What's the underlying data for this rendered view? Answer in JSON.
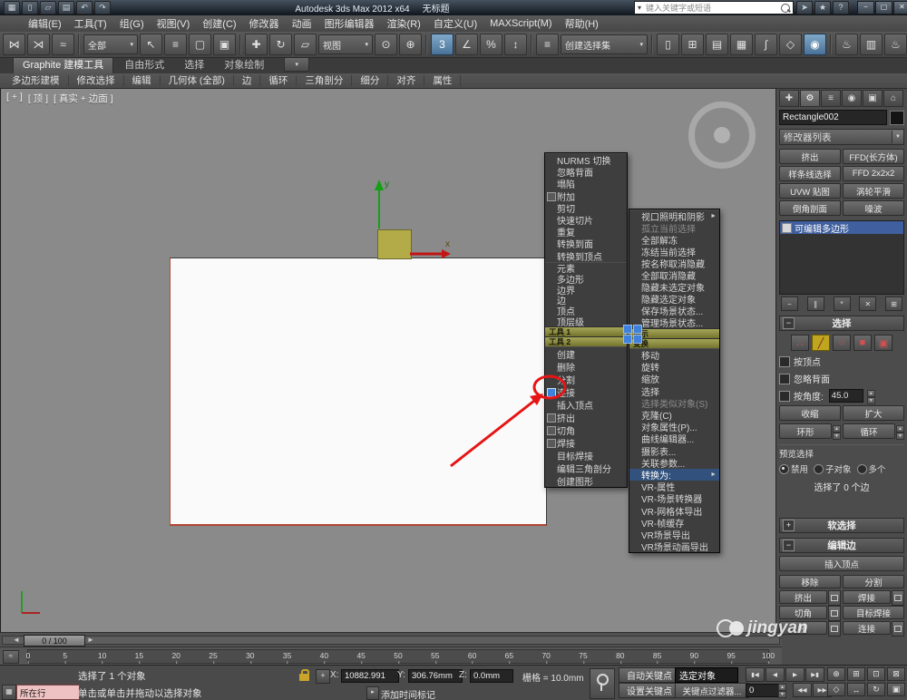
{
  "titlebar": {
    "title": "Autodesk 3ds Max 2012 x64",
    "doc": "无标题",
    "search_placeholder": "键入关键字或短语",
    "qat_icons": [
      {
        "glyph": "▦",
        "name": "app-menu-icon"
      },
      {
        "glyph": "▯",
        "name": "new-scene-icon"
      },
      {
        "glyph": "▱",
        "name": "open-file-icon"
      },
      {
        "glyph": "▤",
        "name": "save-file-icon"
      },
      {
        "glyph": "↶",
        "name": "undo-icon"
      },
      {
        "glyph": "↷",
        "name": "redo-icon"
      }
    ],
    "right_icons": [
      {
        "glyph": "➤",
        "name": "communication-center-icon"
      },
      {
        "glyph": "★",
        "name": "favorites-icon"
      },
      {
        "glyph": "?",
        "name": "help-icon"
      }
    ],
    "window_buttons": [
      {
        "glyph": "−",
        "name": "minimize-button"
      },
      {
        "glyph": "▢",
        "name": "maximize-button"
      },
      {
        "glyph": "✕",
        "name": "close-button"
      }
    ]
  },
  "menubar": [
    "编辑(E)",
    "工具(T)",
    "组(G)",
    "视图(V)",
    "创建(C)",
    "修改器",
    "动画",
    "图形编辑器",
    "渲染(R)",
    "自定义(U)",
    "MAXScript(M)",
    "帮助(H)"
  ],
  "toolbar": {
    "items": [
      {
        "glyph": "⋈",
        "name": "select-and-link-icon"
      },
      {
        "glyph": "⋊",
        "name": "unlink-selection-icon"
      },
      {
        "glyph": "≈",
        "name": "bind-to-space-warp-icon"
      },
      {
        "cls": "sep",
        "name": "toolbar-separator",
        "inter": "false"
      },
      {
        "label": "全部",
        "arrow": "▾",
        "cls": "tdrop",
        "name": "selection-filter-dropdown"
      },
      {
        "glyph": "↖",
        "name": "select-object-icon"
      },
      {
        "glyph": "≡",
        "name": "select-by-name-icon"
      },
      {
        "glyph": "▢",
        "name": "selection-region-icon"
      },
      {
        "glyph": "▣",
        "name": "window-crossing-icon"
      },
      {
        "cls": "sep",
        "name": "toolbar-separator",
        "inter": "false"
      },
      {
        "glyph": "✚",
        "name": "select-and-move-icon"
      },
      {
        "glyph": "↻",
        "name": "select-and-rotate-icon"
      },
      {
        "glyph": "▱",
        "name": "select-and-scale-icon"
      },
      {
        "label": "视图",
        "arrow": "▾",
        "cls": "tdrop",
        "name": "reference-coordinate-dropdown"
      },
      {
        "glyph": "⊙",
        "name": "use-pivot-center-icon"
      },
      {
        "glyph": "⊕",
        "name": "select-and-manipulate-icon"
      },
      {
        "cls": "sep",
        "name": "toolbar-separator",
        "inter": "false"
      },
      {
        "glyph": "3",
        "name": "snaps-toggle-icon",
        "active": true
      },
      {
        "glyph": "∠",
        "name": "angle-snap-icon"
      },
      {
        "glyph": "%",
        "name": "percent-snap-icon"
      },
      {
        "glyph": "↕",
        "name": "spinner-snap-icon"
      },
      {
        "cls": "sep",
        "name": "toolbar-separator",
        "inter": "false"
      },
      {
        "glyph": "≡",
        "name": "edit-named-selections-icon"
      },
      {
        "label": "创建选择集",
        "arrow": "▾",
        "cls": "tdrop wide",
        "name": "named-selection-sets-combo"
      },
      {
        "cls": "sep",
        "name": "toolbar-separator",
        "inter": "false"
      },
      {
        "glyph": "▯",
        "name": "mirror-icon"
      },
      {
        "glyph": "⊞",
        "name": "align-icon"
      },
      {
        "glyph": "▤",
        "name": "layer-manager-icon"
      },
      {
        "glyph": "▦",
        "name": "ribbon-toggle-icon"
      },
      {
        "glyph": "∫",
        "name": "curve-editor-icon"
      },
      {
        "glyph": "◇",
        "name": "schematic-view-icon"
      },
      {
        "glyph": "◉",
        "name": "material-editor-icon",
        "active": true
      },
      {
        "cls": "sep",
        "name": "toolbar-separator",
        "inter": "false"
      },
      {
        "glyph": "♨",
        "name": "render-setup-icon"
      },
      {
        "glyph": "▥",
        "name": "rendered-frame-icon"
      },
      {
        "glyph": "♨",
        "name": "render-icon"
      }
    ]
  },
  "ribbon": {
    "tabs": [
      {
        "label": "Graphite 建模工具",
        "active": true,
        "name": "tab-graphite-modeling-tools"
      },
      {
        "label": "自由形式",
        "name": "tab-freeform"
      },
      {
        "label": "选择",
        "name": "tab-selection"
      },
      {
        "label": "对象绘制",
        "name": "tab-object-paint"
      },
      {
        "glyph": "▾",
        "cls": "rtab-mini",
        "name": "ribbon-minimize-button"
      }
    ],
    "sections": [
      "多边形建模",
      "修改选择",
      "编辑",
      "几何体 (全部)",
      "边",
      "循环",
      "三角剖分",
      "细分",
      "对齐",
      "属性"
    ]
  },
  "viewport": {
    "labels": [
      "[ + ]",
      "[ 顶 ]",
      "[ 真实 + 边面 ]"
    ],
    "axis_x": "x",
    "axis_y": "y"
  },
  "quad": {
    "tools1_header": "工具 1",
    "tools2_header": "工具 2",
    "display_header": "显示",
    "transform_header": "变换",
    "tools1_items": [
      {
        "label": "NURMS 切换"
      },
      {
        "label": "忽略背面"
      },
      {
        "label": "塌陷"
      },
      {
        "label": "附加",
        "box": true
      },
      {
        "label": "剪切"
      },
      {
        "label": "快速切片"
      },
      {
        "label": "重复"
      },
      {
        "label": "转换到面"
      },
      {
        "label": "转换到顶点"
      }
    ],
    "subobj_items": [
      {
        "label": "元素"
      },
      {
        "label": "多边形"
      },
      {
        "label": "边界"
      },
      {
        "label": "边"
      },
      {
        "label": "顶点"
      },
      {
        "label": "顶层级"
      }
    ],
    "tools2_items": [
      {
        "label": "创建"
      },
      {
        "label": "删除"
      },
      {
        "label": "分割"
      },
      {
        "label": "连接",
        "box": true,
        "blue": true,
        "name": "quad-menu-item-connect"
      },
      {
        "label": "插入顶点"
      },
      {
        "label": "挤出",
        "box": true
      },
      {
        "label": "切角",
        "box": true
      },
      {
        "label": "焊接",
        "box": true
      },
      {
        "label": "目标焊接"
      },
      {
        "label": "编辑三角剖分"
      },
      {
        "label": "创建图形"
      }
    ],
    "display_items": [
      {
        "label": "视口照明和阴影",
        "arrow": true
      },
      {
        "label": "孤立当前选择",
        "disabled": true
      },
      {
        "label": "全部解冻"
      },
      {
        "label": "冻结当前选择"
      },
      {
        "label": "按名称取消隐藏"
      },
      {
        "label": "全部取消隐藏"
      },
      {
        "label": "隐藏未选定对象"
      },
      {
        "label": "隐藏选定对象"
      },
      {
        "label": "保存场景状态..."
      },
      {
        "label": "管理场景状态..."
      }
    ],
    "transform_items": [
      {
        "label": "移动"
      },
      {
        "label": "旋转"
      },
      {
        "label": "缩放"
      },
      {
        "label": "选择"
      },
      {
        "label": "选择类似对象(S)",
        "disabled": true
      },
      {
        "label": "克隆(C)"
      },
      {
        "label": "对象属性(P)..."
      },
      {
        "label": "曲线编辑器..."
      },
      {
        "label": "摄影表..."
      },
      {
        "label": "关联参数..."
      },
      {
        "label": "转换为:",
        "arrow": true,
        "hl": true
      },
      {
        "label": "VR-属性"
      },
      {
        "label": "VR-场景转换器"
      },
      {
        "label": "VR-网格体导出"
      },
      {
        "label": "VR-帧缓存"
      },
      {
        "label": "VR场景导出"
      },
      {
        "label": "VR场景动画导出"
      }
    ]
  },
  "panel": {
    "tabs": [
      {
        "glyph": "✚",
        "name": "create-panel-tab"
      },
      {
        "glyph": "⚙",
        "name": "modify-panel-tab",
        "active": true
      },
      {
        "glyph": "≡",
        "name": "hierarchy-panel-tab"
      },
      {
        "glyph": "◉",
        "name": "motion-panel-tab"
      },
      {
        "glyph": "▣",
        "name": "display-panel-tab"
      },
      {
        "glyph": "⌂",
        "name": "utilities-panel-tab"
      }
    ],
    "name_value": "Rectangle002",
    "modifier_list_label": "修改器列表",
    "modifier_buttons": [
      "挤出",
      "FFD(长方体)",
      "样条线选择",
      "FFD 2x2x2",
      "UVW 贴图",
      "涡轮平滑",
      "倒角剖面",
      "噪波"
    ],
    "stack_item": "可编辑多边形",
    "stack_tools": [
      {
        "glyph": "−",
        "name": "pin-stack-icon"
      },
      {
        "glyph": "∥",
        "name": "show-end-result-icon"
      },
      {
        "glyph": "*",
        "name": "make-unique-icon"
      },
      {
        "glyph": "✕",
        "name": "remove-modifier-icon"
      },
      {
        "glyph": "⊞",
        "name": "configure-modifier-sets-icon"
      }
    ],
    "rollout_selection": "选择",
    "subobj": [
      {
        "glyph": "∴",
        "name": "vertex-subobject-icon"
      },
      {
        "glyph": "╱",
        "name": "edge-subobject-icon",
        "active": true
      },
      {
        "glyph": "○",
        "name": "border-subobject-icon"
      },
      {
        "glyph": "■",
        "name": "polygon-subobject-icon"
      },
      {
        "glyph": "▣",
        "name": "element-subobject-icon"
      }
    ],
    "checkbox_by_vertex": "按顶点",
    "checkbox_ignore_backfacing": "忽略背面",
    "checkbox_by_angle": "按角度:",
    "angle_value": "45.0",
    "btn_shrink": "收缩",
    "btn_grow": "扩大",
    "btn_ring": "环形",
    "btn_loop": "循环",
    "preview_label": "预览选择",
    "preview_options": [
      "禁用",
      "子对象",
      "多个"
    ],
    "status_text": "选择了 0 个边",
    "rollout_soft": "软选择",
    "rollout_edit_edges": "编辑边",
    "btn_insert_vertex": "插入顶点",
    "edit_cells": [
      {
        "label": "移除",
        "name": "remove-button"
      },
      {
        "label": "分割",
        "name": "split-button"
      },
      {
        "label": "挤出",
        "box": true,
        "name": "extrude-button"
      },
      {
        "label": "焊接",
        "box": true,
        "name": "weld-button"
      },
      {
        "label": "切角",
        "box": true,
        "name": "chamfer-button"
      },
      {
        "label": "目标焊接",
        "name": "target-weld-button"
      },
      {
        "label": "桥",
        "box": true,
        "name": "bridge-button"
      },
      {
        "label": "连接",
        "box": true,
        "name": "connect-button"
      }
    ]
  },
  "timeline": {
    "handle": "0 / 100",
    "ticks": [
      "0",
      "5",
      "10",
      "15",
      "20",
      "25",
      "30",
      "35",
      "40",
      "45",
      "50",
      "55",
      "60",
      "65",
      "70",
      "75",
      "80",
      "85",
      "90",
      "95",
      "100"
    ]
  },
  "status": {
    "listener_text": "所在行",
    "selection": "选择了 1 个对象",
    "prompt": "单击或单击并拖动以选择对象",
    "x_label": "X:",
    "x": "10882.991",
    "y_label": "Y:",
    "y": "306.76mm",
    "z_label": "Z:",
    "z": "0.0mm",
    "grid": "栅格 = 10.0mm",
    "add_time_tag": "添加时间标记",
    "auto_key": "自动关键点",
    "selected_combo": "选定对象",
    "set_key": "设置关键点",
    "key_filters": "关键点过滤器...",
    "frame": "0",
    "time_row1": [
      {
        "glyph": "▮◀",
        "name": "go-to-start-button"
      },
      {
        "glyph": "◀",
        "name": "previous-frame-button"
      },
      {
        "glyph": "▶",
        "name": "play-button"
      },
      {
        "glyph": "▶▮",
        "name": "go-to-end-button"
      }
    ],
    "time_row2": [
      {
        "glyph": "◀◀",
        "name": "key-step-back-button"
      },
      {
        "glyph": "▶▶",
        "name": "key-step-forward-button"
      }
    ],
    "nav": [
      {
        "glyph": "⊕",
        "name": "zoom-button"
      },
      {
        "glyph": "⊞",
        "name": "zoom-all-button"
      },
      {
        "glyph": "⊡",
        "name": "zoom-extents-button"
      },
      {
        "glyph": "⊠",
        "name": "zoom-extents-all-button"
      },
      {
        "glyph": "◇",
        "name": "field-of-view-button"
      },
      {
        "glyph": "↔",
        "name": "pan-button"
      },
      {
        "glyph": "↻",
        "name": "orbit-button"
      },
      {
        "glyph": "▣",
        "name": "maximize-viewport-button"
      }
    ]
  },
  "watermark": "jingyan"
}
